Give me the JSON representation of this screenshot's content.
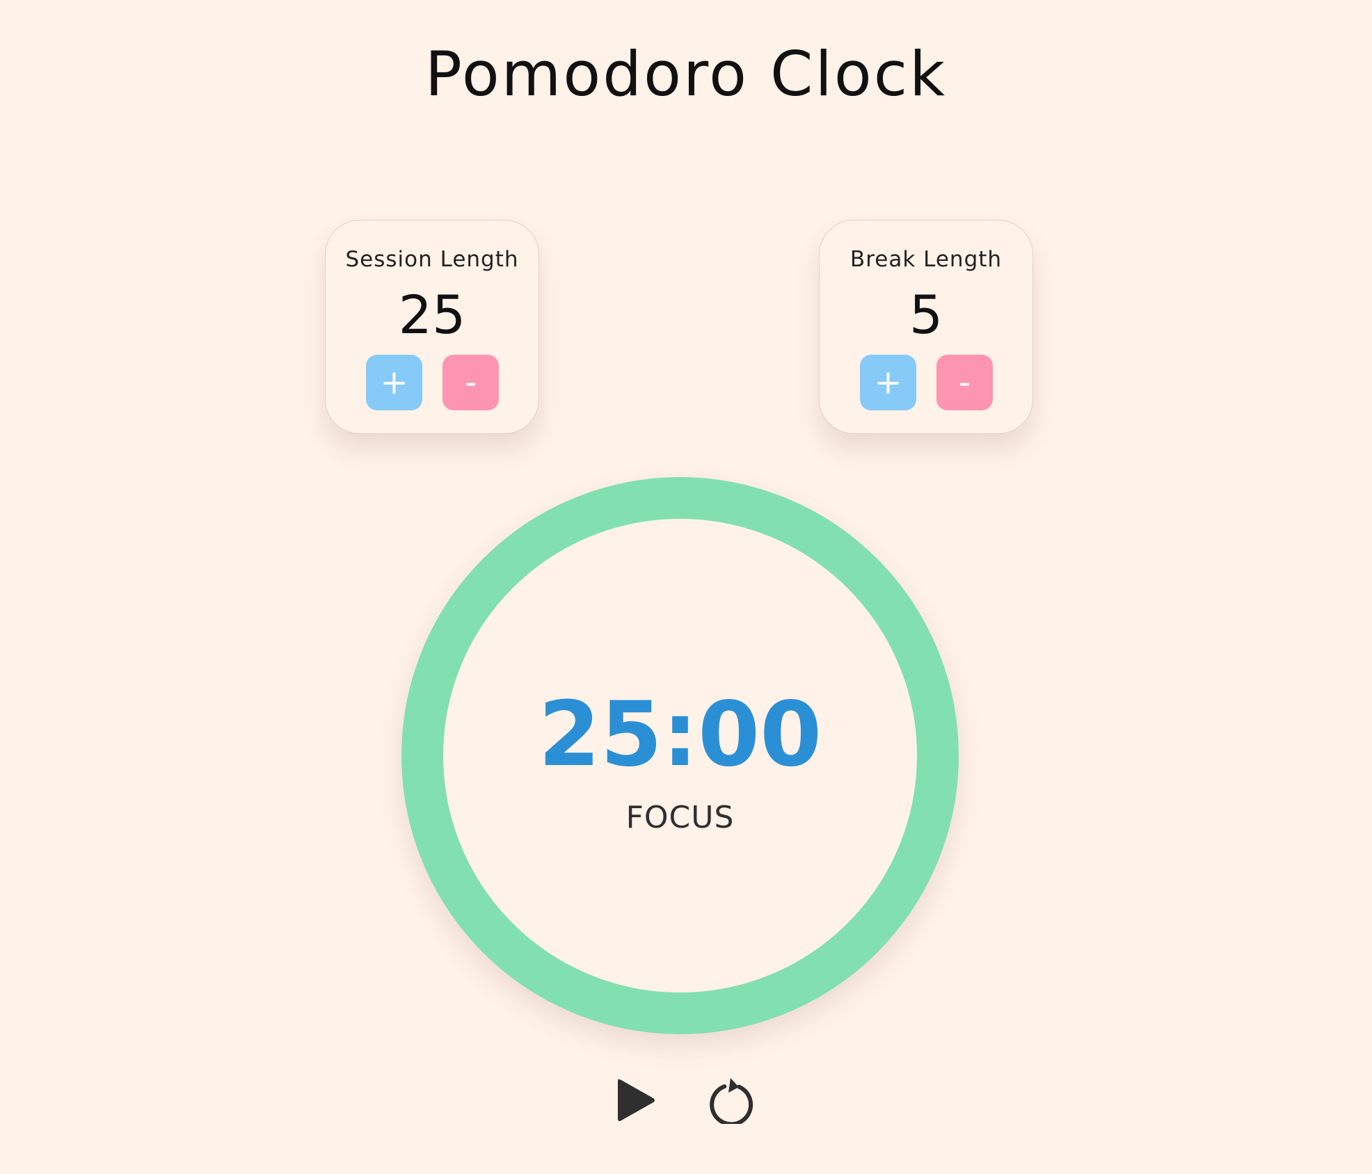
{
  "app": {
    "title": "Pomodoro Clock"
  },
  "session": {
    "label": "Session Length",
    "value": "25",
    "increment_label": "+",
    "decrement_label": "-"
  },
  "break": {
    "label": "Break Length",
    "value": "5",
    "increment_label": "+",
    "decrement_label": "-"
  },
  "timer": {
    "time": "25:00",
    "mode": "FOCUS",
    "progress": 1.0
  },
  "controls": {
    "play_icon": "play-icon",
    "reset_icon": "reset-icon"
  },
  "colors": {
    "background": "#fff2e9",
    "ring": "#82e0b0",
    "time_text": "#2b8fd6",
    "increment_button": "#86cbf7",
    "decrement_button": "#fd94b1",
    "control_icon": "#2f2f2f"
  }
}
